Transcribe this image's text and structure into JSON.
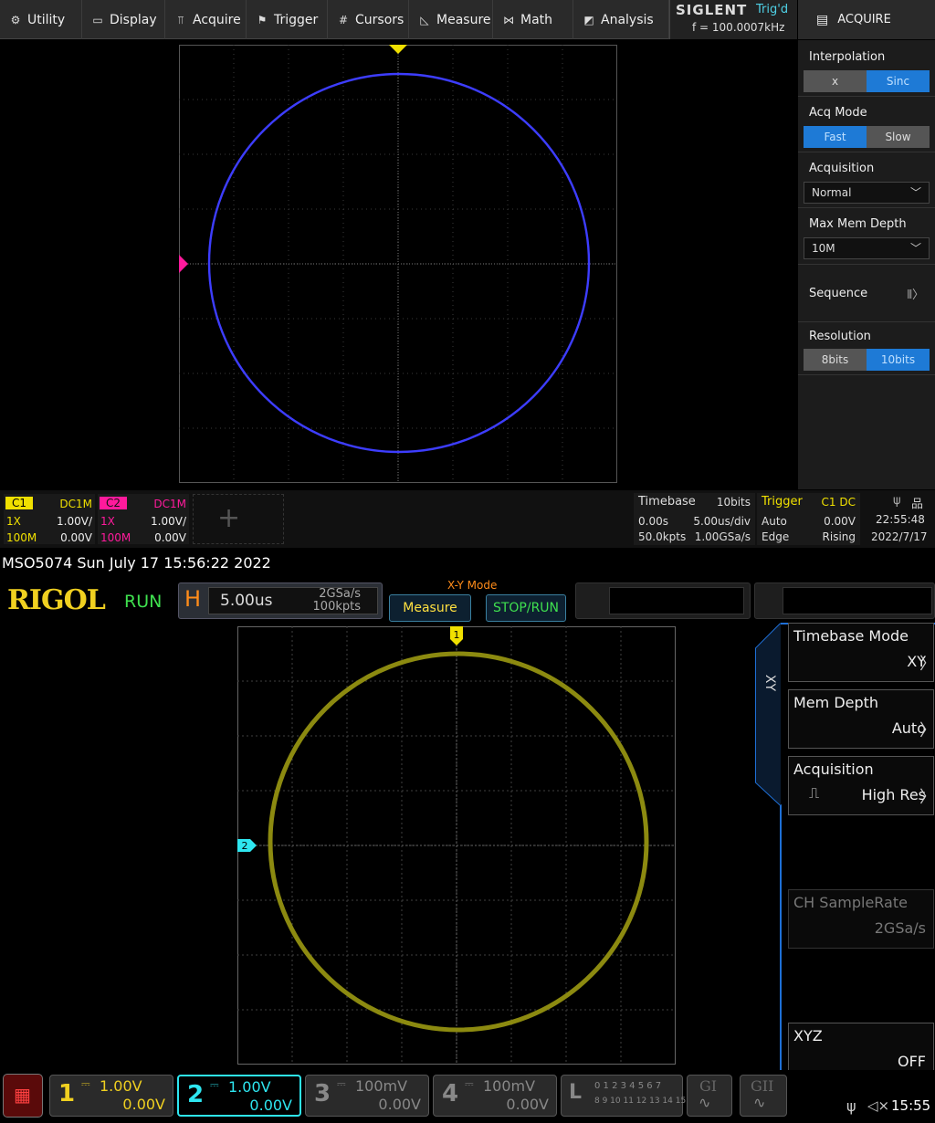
{
  "siglent": {
    "menu": [
      {
        "label": "Utility",
        "icon": "gear-icon"
      },
      {
        "label": "Display",
        "icon": "monitor-icon"
      },
      {
        "label": "Acquire",
        "icon": "acquire-icon"
      },
      {
        "label": "Trigger",
        "icon": "flag-icon"
      },
      {
        "label": "Cursors",
        "icon": "cursors-icon"
      },
      {
        "label": "Measure",
        "icon": "measure-icon"
      },
      {
        "label": "Math",
        "icon": "math-icon"
      },
      {
        "label": "Analysis",
        "icon": "analysis-icon"
      }
    ],
    "brand": "SIGLENT",
    "trig_state": "Trig'd",
    "freq": "f = 100.0007kHz",
    "panel_title": "ACQUIRE",
    "interpolation": {
      "label": "Interpolation",
      "options": [
        "x",
        "Sinc"
      ],
      "selected": "Sinc"
    },
    "acq_mode": {
      "label": "Acq Mode",
      "options": [
        "Fast",
        "Slow"
      ],
      "selected": "Fast"
    },
    "acquisition": {
      "label": "Acquisition",
      "value": "Normal"
    },
    "max_mem_depth": {
      "label": "Max Mem Depth",
      "value": "10M"
    },
    "sequence": {
      "label": "Sequence",
      "icon": "sequence-icon"
    },
    "resolution": {
      "label": "Resolution",
      "options": [
        "8bits",
        "10bits"
      ],
      "selected": "10bits"
    },
    "c1": {
      "name": "C1",
      "coupling": "DC1M",
      "probe": "1X",
      "scale": "1.00V/",
      "bw": "100M",
      "offset": "0.00V",
      "color": "#f0e000"
    },
    "c2": {
      "name": "C2",
      "coupling": "DC1M",
      "probe": "1X",
      "scale": "1.00V/",
      "bw": "100M",
      "offset": "0.00V",
      "color": "#ff1a9c"
    },
    "timebase": {
      "label": "Timebase",
      "bits": "10bits",
      "delay": "0.00s",
      "scale": "5.00us/div",
      "points": "50.0kpts",
      "rate": "1.00GSa/s"
    },
    "trigger": {
      "label": "Trigger",
      "source": "C1 DC",
      "mode": "Auto",
      "level": "0.00V",
      "type": "Edge",
      "slope": "Rising"
    },
    "clock": {
      "time": "22:55:48",
      "date": "2022/7/17"
    },
    "trace_color": "#3d3dff"
  },
  "rigol": {
    "model_line": "MSO5074  Sun July 17 15:56:22 2022",
    "logo": "RIGOL",
    "run_state": "RUN",
    "h_label": "H",
    "h_value": "5.00us",
    "sample_rate": "2GSa/s",
    "mem": "100kpts",
    "xy_mode": "X-Y Mode",
    "measure_btn": "Measure",
    "stoprun_btn": "STOP/RUN",
    "side_tab": "XY",
    "softkeys": [
      {
        "title": "Timebase Mode",
        "value": "XY"
      },
      {
        "title": "Mem Depth",
        "value": "Auto"
      },
      {
        "title": "Acquisition",
        "value": "High Res"
      },
      {
        "title": "CH SampleRate",
        "value": "2GSa/s"
      },
      {
        "title": "XYZ",
        "value": "OFF"
      }
    ],
    "channels": [
      {
        "num": "1",
        "scale": "1.00V",
        "offset": "0.00V",
        "color": "#f0d020"
      },
      {
        "num": "2",
        "scale": "1.00V",
        "offset": "0.00V",
        "color": "#2ee6f0"
      },
      {
        "num": "3",
        "scale": "100mV",
        "offset": "0.00V",
        "color": "#888888"
      },
      {
        "num": "4",
        "scale": "100mV",
        "offset": "0.00V",
        "color": "#888888"
      }
    ],
    "la": {
      "label": "L",
      "row1": "0 1 2 3  4 5 6 7",
      "row2": "8 9 10 11 12 13 14 15"
    },
    "g1": "GI",
    "g2": "GII",
    "clock": "15:55",
    "marker1": "1",
    "marker2": "2",
    "trace_color": "#8c8a10"
  }
}
